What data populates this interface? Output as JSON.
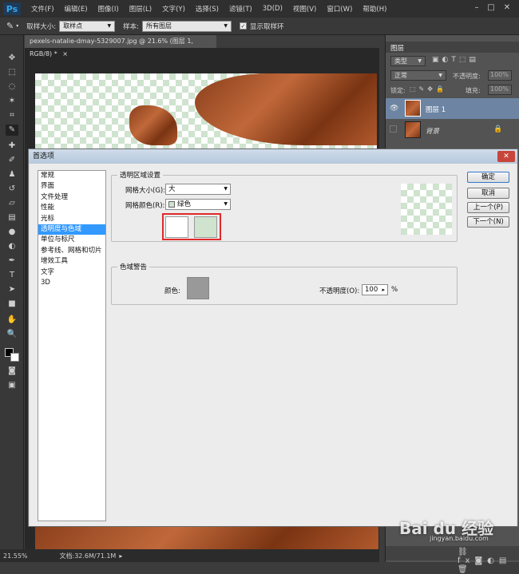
{
  "app": {
    "logo": "Ps"
  },
  "menu": [
    "文件(F)",
    "编辑(E)",
    "图像(I)",
    "图层(L)",
    "文字(Y)",
    "选择(S)",
    "滤镜(T)",
    "3D(D)",
    "视图(V)",
    "窗口(W)",
    "帮助(H)"
  ],
  "options": {
    "sample_size_label": "取样大小:",
    "sample_size_value": "取样点",
    "sample_label": "样本:",
    "sample_value": "所有图层",
    "show_ring_label": "显示取样环"
  },
  "document": {
    "tab_title": "pexels-natalie-dmay-5329007.jpg @ 21.6% (图层 1, RGB/8) *"
  },
  "status": {
    "zoom": "21.55%",
    "doc_info": "文档:32.6M/71.1M"
  },
  "layers_panel": {
    "title": "图层",
    "kind": "类型",
    "blend_mode": "正常",
    "opacity_label": "不透明度:",
    "opacity_value": "100%",
    "lock_label": "锁定:",
    "fill_label": "填充:",
    "fill_value": "100%",
    "layers": [
      {
        "name": "图层 1",
        "selected": true
      },
      {
        "name": "背景",
        "selected": false
      }
    ]
  },
  "dialog": {
    "title": "首选项",
    "close_label": "✕",
    "categories": [
      "常规",
      "界面",
      "文件处理",
      "性能",
      "光标",
      "透明度与色域",
      "单位与标尺",
      "参考线、网格和切片",
      "增效工具",
      "文字",
      "3D"
    ],
    "active_category": 5,
    "transparency": {
      "legend": "透明区域设置",
      "grid_size_label": "网格大小(G):",
      "grid_size_value": "大",
      "grid_colors_label": "网格颜色(R):",
      "grid_colors_value": "绿色",
      "swatch1_color": "#ffffff",
      "swatch2_color": "#cfe3cf"
    },
    "gamut": {
      "legend": "色域警告",
      "color_label": "颜色:",
      "color_value": "#999999",
      "opacity_label": "不透明度(O):",
      "opacity_value": "100",
      "opacity_unit": "%"
    },
    "buttons": {
      "ok": "确定",
      "cancel": "取消",
      "prev": "上一个(P)",
      "next": "下一个(N)"
    }
  },
  "watermark": {
    "text": "Bai du 经验",
    "sub": "jingyan.baidu.com"
  }
}
